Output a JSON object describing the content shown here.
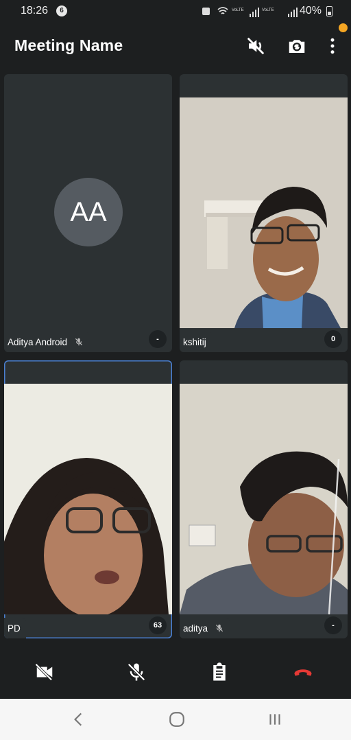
{
  "status_bar": {
    "time": "18:26",
    "notification_count": "6",
    "battery": "40%"
  },
  "app_bar": {
    "title": "Meeting Name"
  },
  "colors": {
    "accent": "#4a7fd0",
    "end_call": "#e53935",
    "notification_dot": "#f5a623",
    "tile_bg": "#2c3133"
  },
  "participants": [
    {
      "name": "Aditya Android",
      "initials": "AA",
      "muted": true,
      "badge": "-",
      "video": false
    },
    {
      "name": "kshitij",
      "muted": false,
      "badge": "0",
      "video": true
    },
    {
      "name": "PD",
      "muted": false,
      "badge": "63",
      "video": true,
      "active_speaker": true
    },
    {
      "name": "aditya",
      "muted": true,
      "badge": "-",
      "video": true
    }
  ],
  "controls": [
    "camera-off-icon",
    "mic-off-icon",
    "clipboard-icon",
    "end-call-icon"
  ],
  "navbar": [
    "back-icon",
    "home-icon",
    "recent-apps-icon"
  ]
}
